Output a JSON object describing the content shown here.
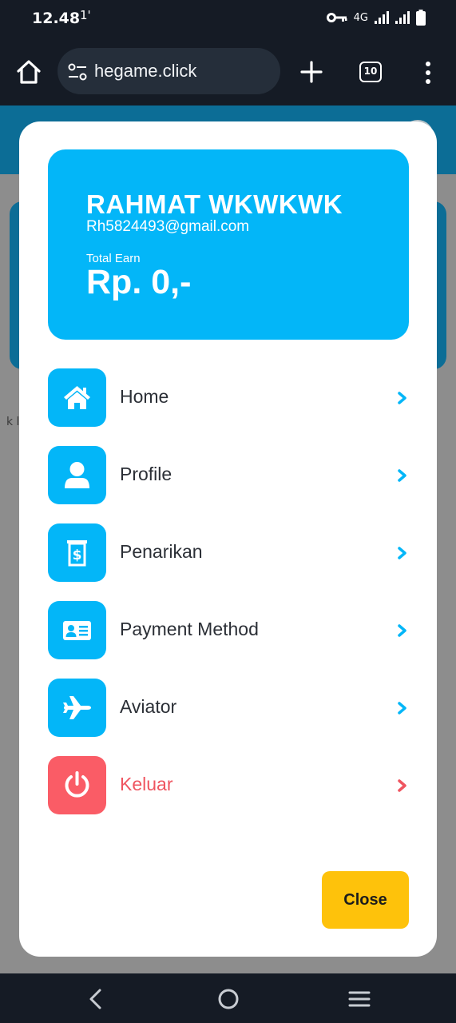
{
  "status_bar": {
    "time": "12.48",
    "notification": "1'",
    "network": "4G",
    "icons": [
      "key-icon",
      "signal-icon",
      "signal-icon",
      "battery-icon"
    ]
  },
  "browser": {
    "url": "hegame.click",
    "tab_count": "10",
    "icons": [
      "home-icon",
      "site-settings-icon",
      "plus-icon",
      "tabs-icon",
      "more-vert-icon"
    ]
  },
  "background_page": {
    "partial_text": "k l"
  },
  "profile": {
    "name": "RAHMAT WKWKWK",
    "email": "Rh5824493@gmail.com",
    "earn_label": "Total Earn",
    "earn_value": "Rp. 0,-"
  },
  "menu": {
    "items": [
      {
        "label": "Home",
        "icon": "home-icon"
      },
      {
        "label": "Profile",
        "icon": "user-icon"
      },
      {
        "label": "Penarikan",
        "icon": "money-withdraw-icon"
      },
      {
        "label": "Payment Method",
        "icon": "id-card-icon"
      },
      {
        "label": "Aviator",
        "icon": "plane-icon"
      },
      {
        "label": "Keluar",
        "icon": "power-icon"
      }
    ]
  },
  "close_label": "Close",
  "colors": {
    "accent": "#03b6f8",
    "danger": "#fa5c66",
    "button": "#fec20b",
    "chrome": "#151b25"
  },
  "navbar": {
    "icons": [
      "back-icon",
      "home-circle-icon",
      "recents-menu-icon"
    ]
  }
}
